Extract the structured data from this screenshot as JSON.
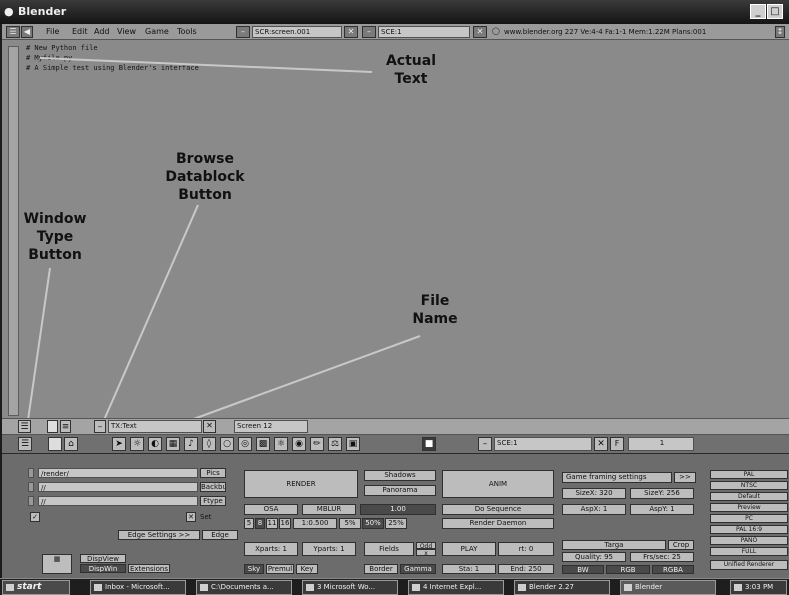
{
  "window": {
    "title": "Blender"
  },
  "top_header": {
    "menus": [
      "File",
      "Edit",
      "Add",
      "View",
      "Game",
      "Tools"
    ],
    "screen_field": "SCR:screen.001",
    "scene_field": "SCE:1",
    "info": "www.blender.org 227 Ve:4-4 Fa:1-1  Mem:1.22M  Plans:001"
  },
  "editor": {
    "code_lines": [
      "# New Python file",
      "# Myfile.py",
      "# A Simple test using Blender's interface"
    ]
  },
  "annotations": {
    "actual_text": "Actual\nText",
    "browse_datablock": "Browse\nDatablock\nButton",
    "window_type": "Window\nType\nButton",
    "file_name": "File\nName"
  },
  "text_header": {
    "file_name": "TX:Text",
    "screen": "Screen 12"
  },
  "buttons_header": {
    "scene": "SCE:1",
    "frame": "1"
  },
  "render_panel": {
    "paths": [
      "/render/",
      "//",
      "//"
    ],
    "path_buttons": [
      "Pics",
      "Backbuf",
      "Ftype"
    ],
    "set_label": "Set",
    "edge_settings": "Edge Settings >>",
    "edge": "Edge",
    "render": "RENDER",
    "shadows": "Shadows",
    "panorama": "Panorama",
    "osa": "OSA",
    "mblur": "MBLUR",
    "filter": "1.00",
    "osa_levels": [
      "5",
      "8",
      "11",
      "16"
    ],
    "motion_blur": "1:0.500",
    "sizes": [
      "5%",
      "50%",
      "25%"
    ],
    "xparts": "Xparts: 1",
    "yparts": "Yparts: 1",
    "fields": "Fields",
    "odd": "Odd",
    "x": "x",
    "sky": "Sky",
    "premul": "Premul",
    "key": "Key",
    "border": "Border",
    "gamma": "Gamma",
    "anim": "ANIM",
    "do_sequence": "Do Sequence",
    "render_daemon": "Render Daemon",
    "play": "PLAY",
    "rt": "rt: 0",
    "sta": "Sta: 1",
    "end": "End: 250",
    "game_framing": "Game framing settings",
    "game_framing_more": ">>",
    "sizex": "SizeX: 320",
    "sizey": "SizeY: 256",
    "aspx": "AspX: 1",
    "aspy": "AspY: 1",
    "targa": "Targa",
    "crop": "Crop",
    "quality": "Quality: 95",
    "frs": "Frs/sec: 25",
    "bw": "BW",
    "rgb": "RGB",
    "rgba": "RGBA",
    "presets": [
      "PAL",
      "NTSC",
      "Default",
      "Preview",
      "PC",
      "PAL 16:9",
      "PANO",
      "FULL",
      "Unified Renderer"
    ],
    "dispview": "DispView",
    "dispwin": "DispWin",
    "extensions": "Extensions"
  },
  "taskbar": {
    "start": "start",
    "tasks": [
      "Inbox - Microsoft...",
      "C:\\Documents a...",
      "3 Microsoft Wo...",
      "4 Internet Expl...",
      "Blender 2.27",
      "Blender"
    ],
    "clock": "3:03 PM"
  }
}
